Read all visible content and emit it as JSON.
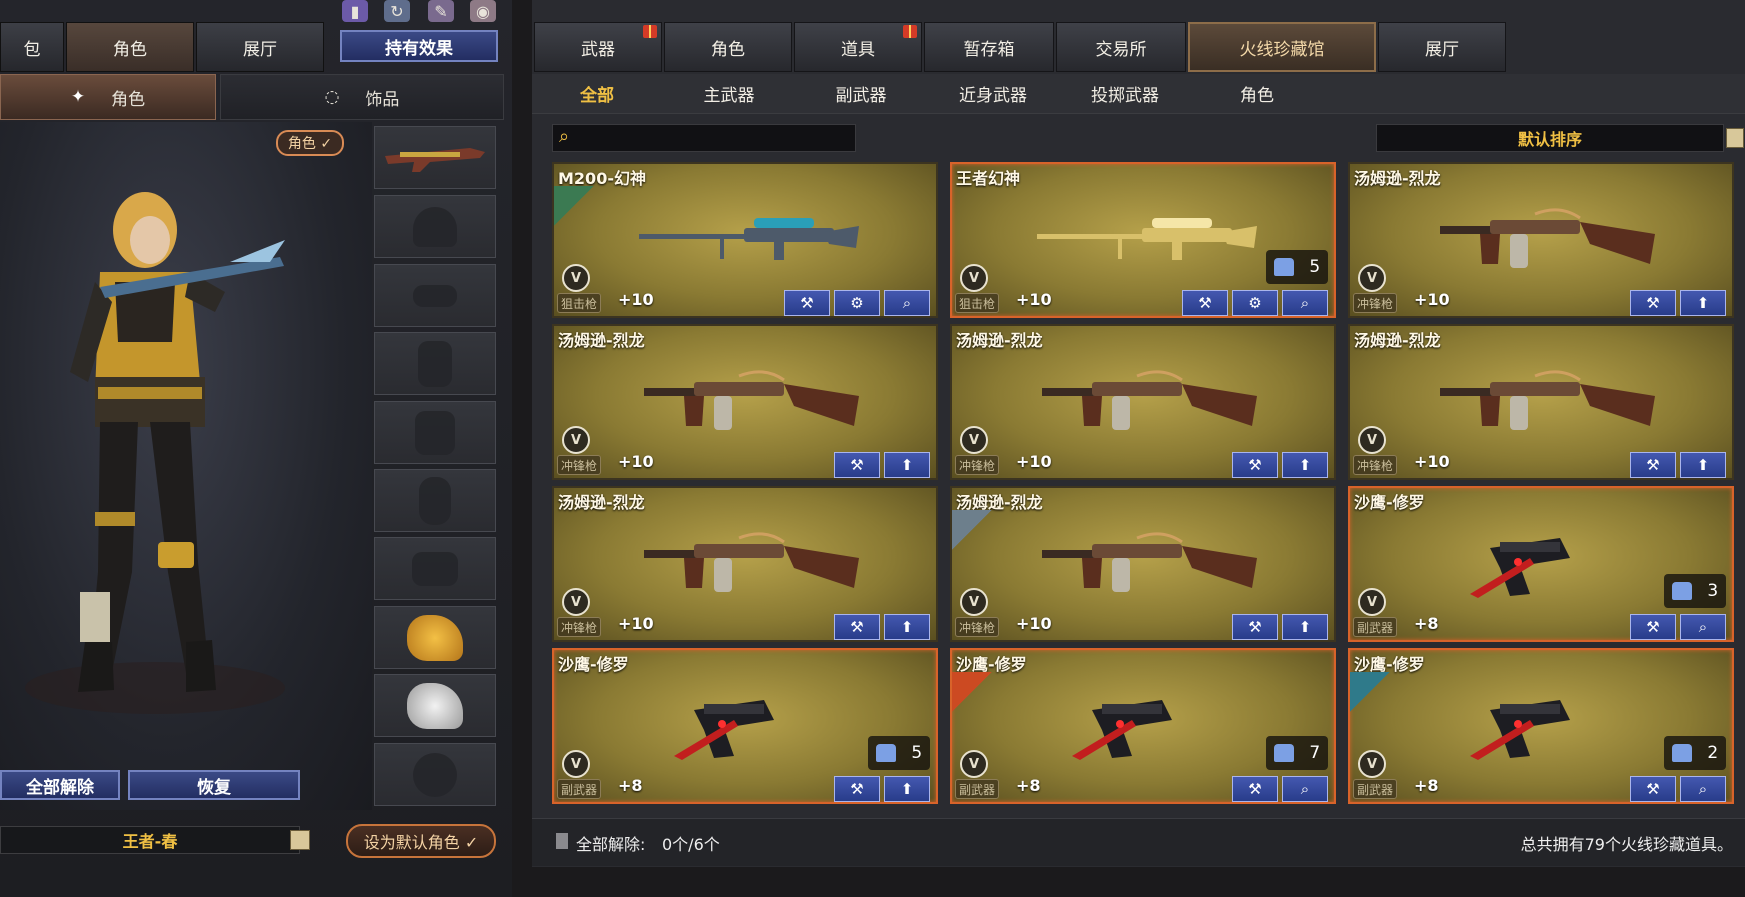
{
  "left": {
    "tabs": [
      "包",
      "角色",
      "展厅"
    ],
    "active_tab": 1,
    "effects_button": "持有效果",
    "sub_tabs": [
      "角色",
      "饰品"
    ],
    "active_sub_tab": 0,
    "role_badge": "角色 ✓",
    "slot_count": 10,
    "unlock_all_button": "全部解除",
    "restore_button": "恢复",
    "character_name": "王者-春",
    "set_default_button": "设为默认角色 ✓"
  },
  "right": {
    "main_tabs": [
      {
        "label": "武器",
        "gift": true
      },
      {
        "label": "角色",
        "gift": false
      },
      {
        "label": "道具",
        "gift": true
      },
      {
        "label": "暂存箱",
        "gift": false
      },
      {
        "label": "交易所",
        "gift": false
      },
      {
        "label": "火线珍藏馆",
        "gift": false
      },
      {
        "label": "展厅",
        "gift": false
      }
    ],
    "active_main_tab": 5,
    "filter_tabs": [
      "全部",
      "主武器",
      "副武器",
      "近身武器",
      "投掷武器",
      "角色"
    ],
    "active_filter_tab": 0,
    "search_placeholder": "",
    "sort_label": "默认排序",
    "items": [
      {
        "name": "M200-幻神",
        "category": "狙击枪",
        "bonus": "+10",
        "count": "",
        "gun": "sniper",
        "highlight": false,
        "buttons": [
          "wrench",
          "gear",
          "search"
        ]
      },
      {
        "name": "王者幻神",
        "category": "狙击枪",
        "bonus": "+10",
        "count": "5",
        "gun": "sniper-gold",
        "highlight": true,
        "buttons": [
          "wrench",
          "gear",
          "search"
        ]
      },
      {
        "name": "汤姆逊-烈龙",
        "category": "冲锋枪",
        "bonus": "+10",
        "count": "",
        "gun": "tommy",
        "highlight": false,
        "buttons": [
          "wrench",
          "up"
        ]
      },
      {
        "name": "汤姆逊-烈龙",
        "category": "冲锋枪",
        "bonus": "+10",
        "count": "",
        "gun": "tommy",
        "highlight": false,
        "buttons": [
          "wrench",
          "up"
        ]
      },
      {
        "name": "汤姆逊-烈龙",
        "category": "冲锋枪",
        "bonus": "+10",
        "count": "",
        "gun": "tommy",
        "highlight": false,
        "buttons": [
          "wrench",
          "up"
        ]
      },
      {
        "name": "汤姆逊-烈龙",
        "category": "冲锋枪",
        "bonus": "+10",
        "count": "",
        "gun": "tommy",
        "highlight": false,
        "buttons": [
          "wrench",
          "up"
        ]
      },
      {
        "name": "汤姆逊-烈龙",
        "category": "冲锋枪",
        "bonus": "+10",
        "count": "",
        "gun": "tommy",
        "highlight": false,
        "buttons": [
          "wrench",
          "up"
        ]
      },
      {
        "name": "汤姆逊-烈龙",
        "category": "冲锋枪",
        "bonus": "+10",
        "count": "",
        "gun": "tommy",
        "highlight": false,
        "buttons": [
          "wrench",
          "up"
        ]
      },
      {
        "name": "沙鹰-修罗",
        "category": "副武器",
        "bonus": "+8",
        "count": "3",
        "gun": "pistol",
        "highlight": true,
        "buttons": [
          "wrench",
          "search"
        ]
      },
      {
        "name": "沙鹰-修罗",
        "category": "副武器",
        "bonus": "+8",
        "count": "5",
        "gun": "pistol",
        "highlight": true,
        "buttons": [
          "wrench",
          "up"
        ]
      },
      {
        "name": "沙鹰-修罗",
        "category": "副武器",
        "bonus": "+8",
        "count": "7",
        "gun": "pistol",
        "highlight": true,
        "buttons": [
          "wrench",
          "search"
        ]
      },
      {
        "name": "沙鹰-修罗",
        "category": "副武器",
        "bonus": "+8",
        "count": "2",
        "gun": "pistol",
        "highlight": true,
        "buttons": [
          "wrench",
          "search"
        ]
      }
    ],
    "footer_unlock_label": "全部解除:",
    "footer_unlock_value": "0个/6个",
    "footer_total": "总共拥有79个火线珍藏道具。"
  },
  "colors": {
    "accent_gold": "#f0c044",
    "button_blue": "#2f42a0",
    "highlight_orange": "#d8632a"
  }
}
